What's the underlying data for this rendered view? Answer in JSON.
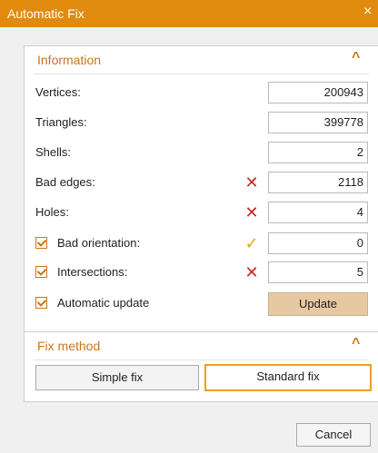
{
  "window": {
    "title": "Automatic Fix",
    "close_glyph": "×"
  },
  "information": {
    "title": "Information",
    "collapse_glyph": "^",
    "rows": [
      {
        "label": "Vertices:",
        "value": "200943"
      },
      {
        "label": "Triangles:",
        "value": "399778"
      },
      {
        "label": "Shells:",
        "value": "2"
      },
      {
        "label": "Bad edges:",
        "value": "2118",
        "status": "x"
      },
      {
        "label": "Holes:",
        "value": "4",
        "status": "x"
      },
      {
        "label": "Bad orientation:",
        "value": "0",
        "status": "ok",
        "checked": true
      },
      {
        "label": "Intersections:",
        "value": "5",
        "status": "x",
        "checked": true
      }
    ],
    "automatic_update_label": "Automatic update",
    "automatic_update_checked": true,
    "update_button": "Update"
  },
  "fix_method": {
    "title": "Fix method",
    "collapse_glyph": "^",
    "options": [
      "Simple fix",
      "Standard fix"
    ],
    "selected": "Standard fix"
  },
  "footer": {
    "cancel_button": "Cancel"
  },
  "icons": {
    "x_glyph": "✕",
    "ok_glyph": "✓"
  },
  "colors": {
    "accent": "#e08a0e",
    "header_text": "#c8761b",
    "error": "#c62828",
    "warning_ok": "#e7a21b"
  }
}
